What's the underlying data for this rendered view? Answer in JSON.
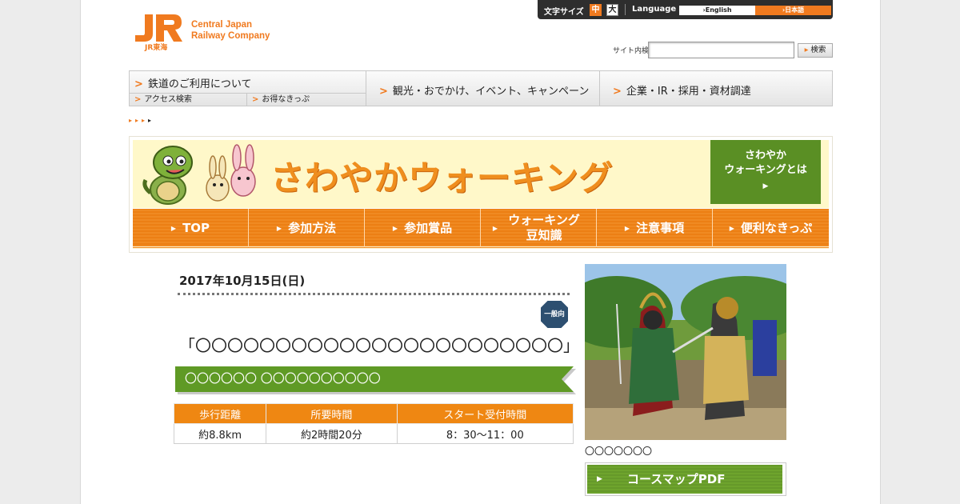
{
  "header": {
    "logo_mark": "JR",
    "logo_sub": "JR東海",
    "logo_line1": "Central Japan",
    "logo_line2": "Railway Company"
  },
  "utility": {
    "font_size_label": "文字サイズ",
    "size_medium": "中",
    "size_large": "大",
    "language_label": "Language",
    "english": "English",
    "japanese": "日本語"
  },
  "search": {
    "label": "サイト内検索",
    "value": "",
    "button": "検索"
  },
  "global_nav": {
    "railway": "鉄道のご利用について",
    "access": "アクセス検索",
    "tickets": "お得なきっぷ",
    "tourism": "観光・おでかけ、イベント、キャンペーン",
    "corporate": "企業・IR・採用・資材調達"
  },
  "breadcrumb": [
    "▸",
    "▸",
    "▸",
    "▸"
  ],
  "banner": {
    "title": "さわやかウォーキング",
    "about_line1": "さわやか",
    "about_line2": "ウォーキングとは",
    "about_arrow": "▶",
    "nav": [
      "TOP",
      "参加方法",
      "参加賞品",
      "ウォーキング 豆知識",
      "注意事項",
      "便利なきっぷ"
    ]
  },
  "event": {
    "date": "2017年10月15日(日)",
    "badge": "一般向",
    "title": "「〇〇〇〇〇〇〇〇〇〇〇〇〇〇〇〇〇〇〇〇〇〇〇」",
    "subtitle": "〇〇〇〇〇〇 〇〇〇〇〇〇〇〇〇〇",
    "table_headers": [
      "歩行距離",
      "所要時間",
      "スタート受付時間"
    ],
    "table_values": [
      "約8.8km",
      "約2時間20分",
      "8：30～11：00"
    ]
  },
  "sidebar": {
    "photo_caption": "〇〇〇〇〇〇〇",
    "pdf_button": "コースマップPDF"
  },
  "colors": {
    "brand_orange": "#f07a1f",
    "green": "#5f9a25",
    "banner_yellow": "#fff8c9"
  }
}
